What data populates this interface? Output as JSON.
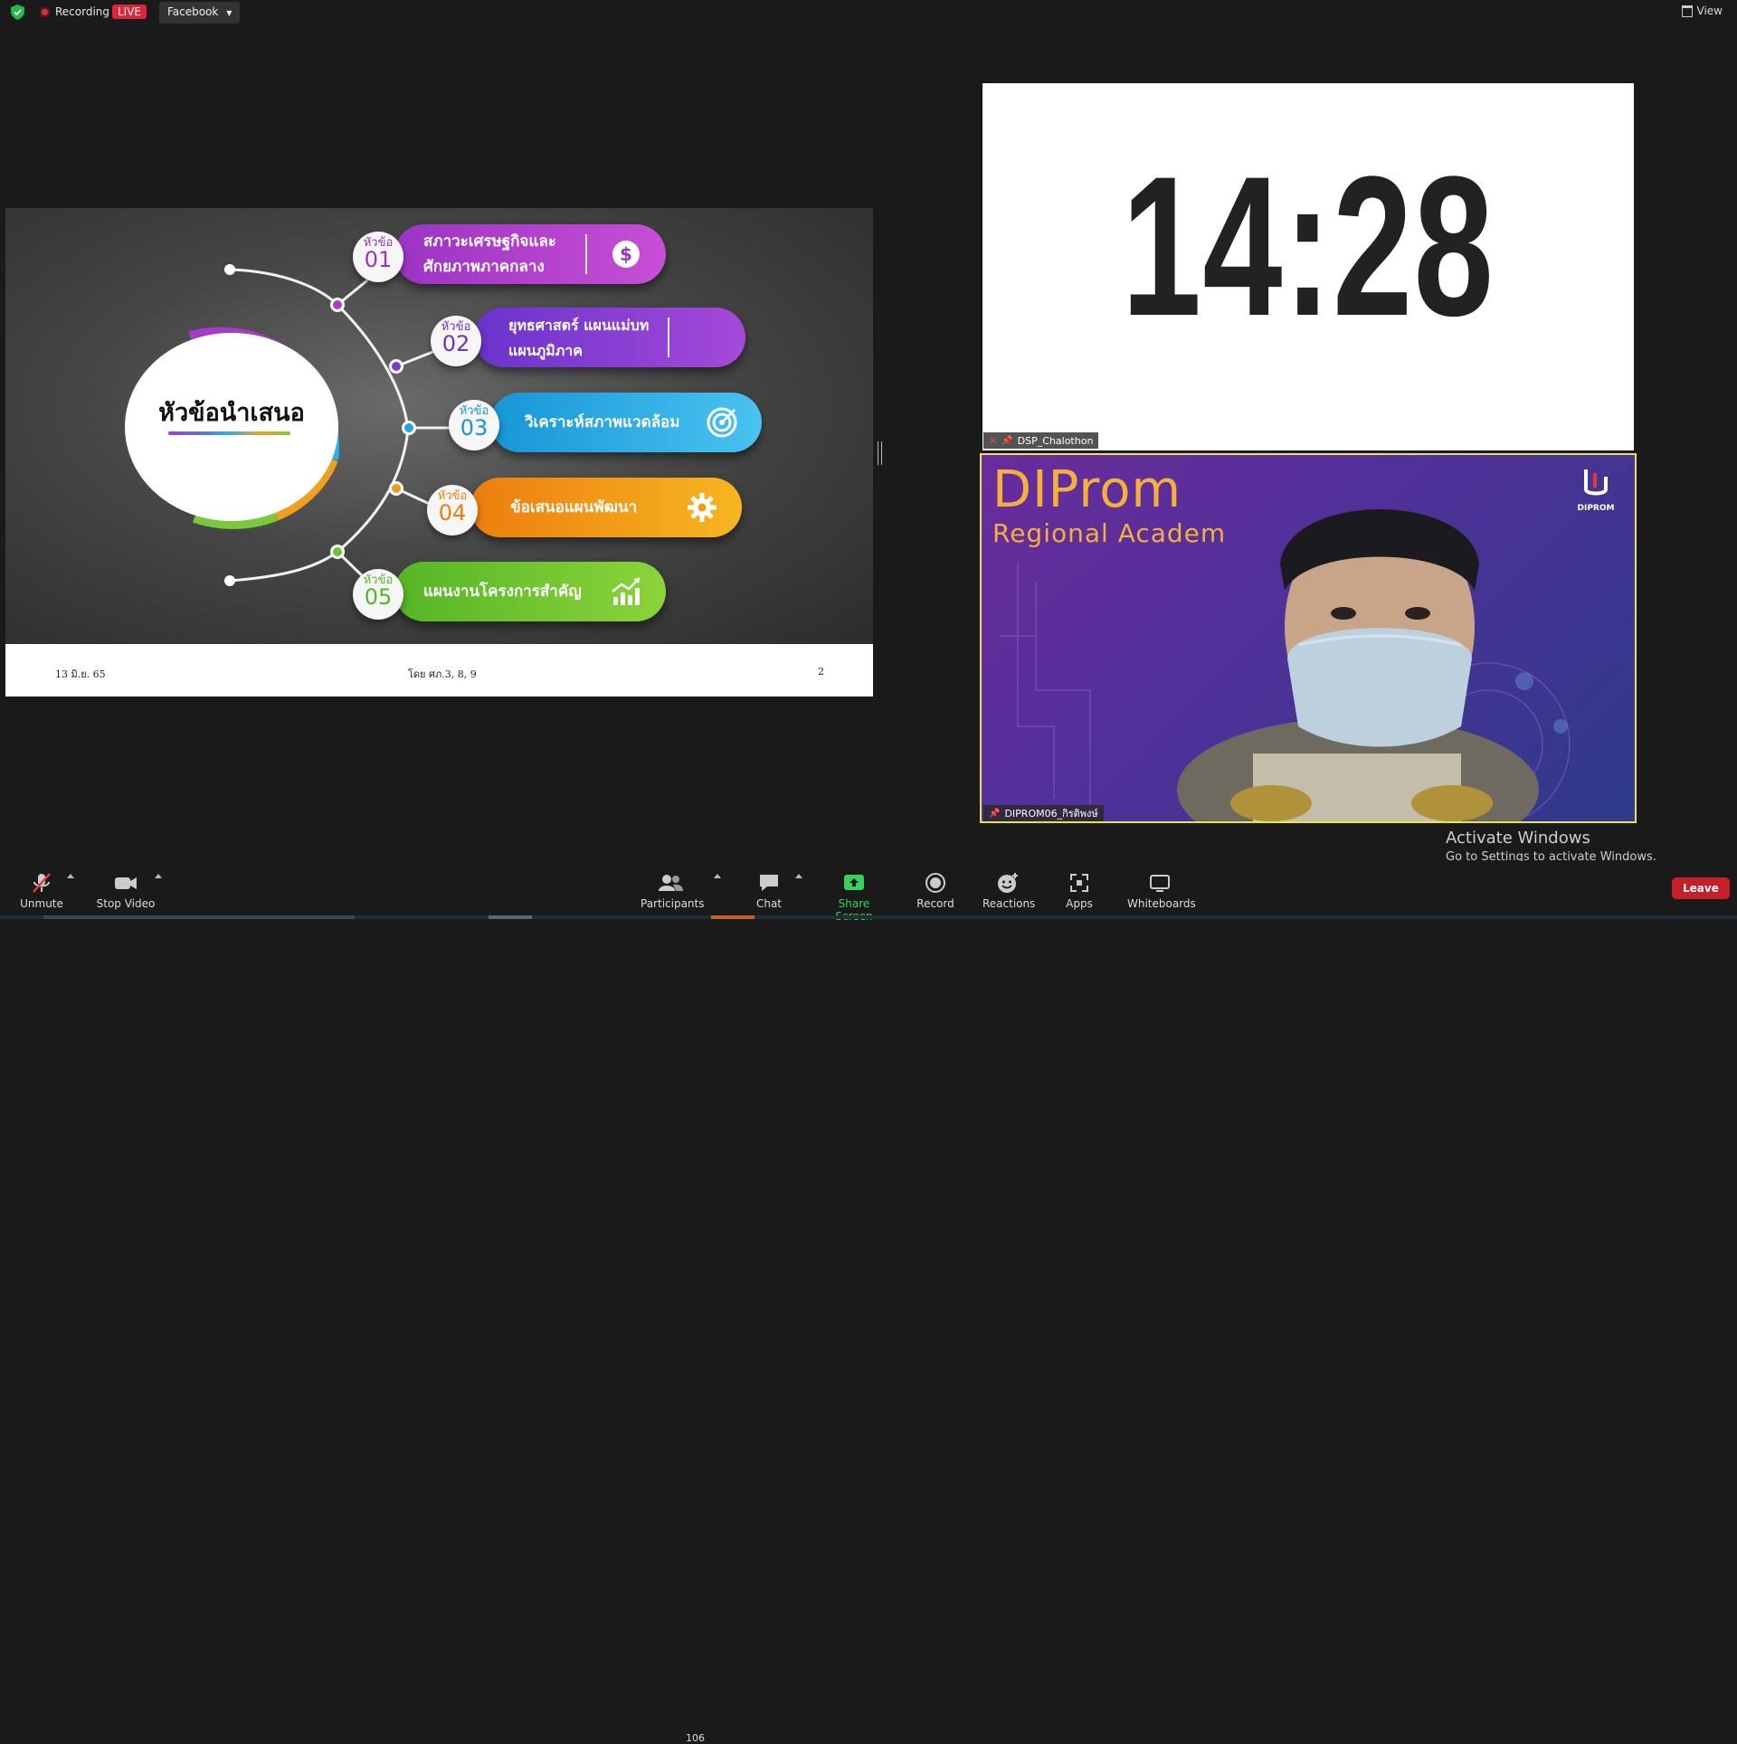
{
  "topbar": {
    "recording_label": "Recording",
    "live_label": "LIVE",
    "stream_target": "Facebook",
    "view_label": "View"
  },
  "slide": {
    "center_title": "หัวข้อนำเสนอ",
    "topics": [
      {
        "badge_word": "หัวข้อ",
        "number": "01",
        "line1": "สภาวะเศรษฐกิจและ",
        "line2": "ศักยภาพภาคกลาง",
        "icon": "dollar-icon",
        "color": "#b03cc8"
      },
      {
        "badge_word": "หัวข้อ",
        "number": "02",
        "line1": "ยุทธศาสตร์ แผนแม่บท",
        "line2": "แผนภูมิภาค",
        "icon": "none",
        "color": "#7a3ed6"
      },
      {
        "badge_word": "หัวข้อ",
        "number": "03",
        "line1": "วิเคราะห์สภาพแวดล้อม",
        "line2": "",
        "icon": "target-icon",
        "color": "#1fa8e0"
      },
      {
        "badge_word": "หัวข้อ",
        "number": "04",
        "line1": "ข้อเสนอแผนพัฒนา",
        "line2": "",
        "icon": "gear-icon",
        "color": "#f29a16"
      },
      {
        "badge_word": "หัวข้อ",
        "number": "05",
        "line1": "แผนงานโครงการสำคัญ",
        "line2": "",
        "icon": "growth-chart-icon",
        "color": "#72c22e"
      }
    ],
    "footer": {
      "date": "13 มิ.ย. 65",
      "by": "โดย ศภ.3, 8, 9",
      "page": "2"
    }
  },
  "timer": {
    "time": "14:28",
    "participant_name": "DSP_Chalothon"
  },
  "video": {
    "logo_main": "DIProm",
    "logo_sub": "Regional Academ",
    "corner_logo": "DIPROM",
    "participant_name": "DIPROM06_กิรติพงษ์"
  },
  "watermark": {
    "line1": "Activate Windows",
    "line2": "Go to Settings to activate Windows."
  },
  "toolbar": {
    "unmute": "Unmute",
    "stop_video": "Stop Video",
    "participants": "Participants",
    "participants_count": "106",
    "chat": "Chat",
    "share_screen": "Share Screen",
    "record": "Record",
    "reactions": "Reactions",
    "apps": "Apps",
    "whiteboards": "Whiteboards",
    "leave": "Leave"
  },
  "colors": {
    "accent_green": "#38d15e",
    "live_red": "#e0253b",
    "leave_red": "#c5202a",
    "active_speaker_border": "#e8e25c"
  }
}
